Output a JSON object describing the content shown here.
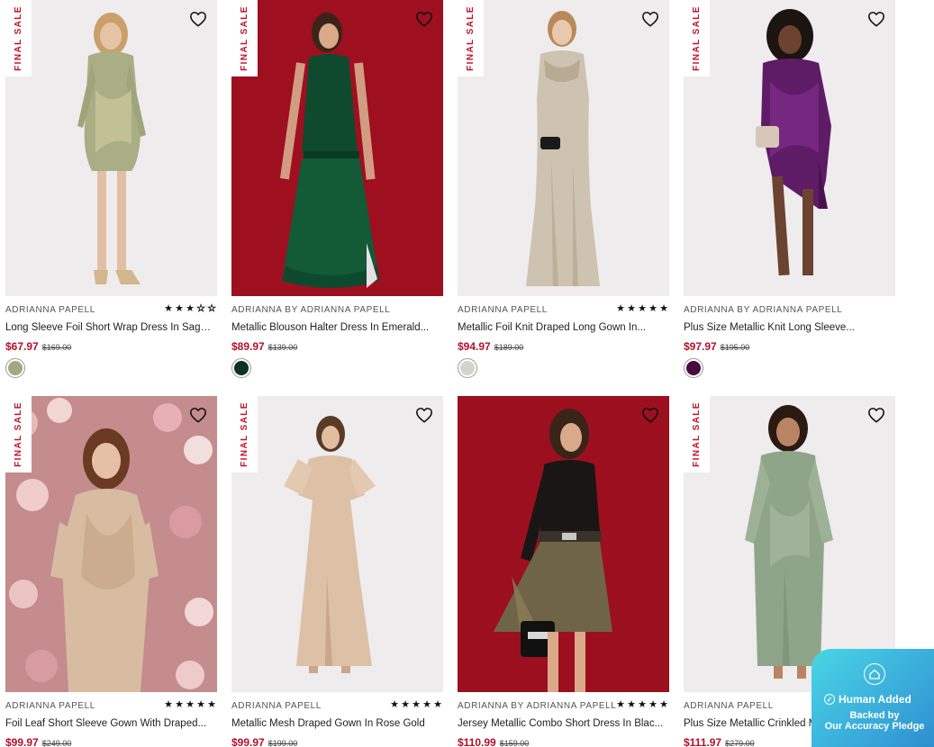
{
  "badge_text": "FINAL SALE",
  "colors": {
    "accent_red": "#b3112a",
    "badge_red": "#c3132a"
  },
  "products": [
    {
      "brand": "ADRIANNA PAPELL",
      "name": "Long Sleeve Foil Short Wrap Dress In Sage...",
      "price": "$67.97",
      "original_price": "$169.00",
      "rating": 2.5,
      "final_sale": true,
      "swatch": "#a8a585"
    },
    {
      "brand": "ADRIANNA BY ADRIANNA PAPELL",
      "name": "Metallic Blouson Halter Dress In Emerald...",
      "price": "$89.97",
      "original_price": "$139.00",
      "rating": null,
      "final_sale": true,
      "swatch": "#0c3322"
    },
    {
      "brand": "ADRIANNA PAPELL",
      "name": "Metallic Foil Knit Draped Long Gown In...",
      "price": "$94.97",
      "original_price": "$189.00",
      "rating": 4.5,
      "final_sale": true,
      "swatch": "#d7d3ca"
    },
    {
      "brand": "ADRIANNA BY ADRIANNA PAPELL",
      "name": "Plus Size Metallic Knit Long Sleeve...",
      "price": "$97.97",
      "original_price": "$195.00",
      "rating": null,
      "final_sale": true,
      "swatch": "#4a0a3e"
    },
    {
      "brand": "ADRIANNA PAPELL",
      "name": "Foil Leaf Short Sleeve Gown With Draped...",
      "price": "$99.97",
      "original_price": "$249.00",
      "rating": 5,
      "final_sale": true,
      "swatch": null
    },
    {
      "brand": "ADRIANNA PAPELL",
      "name": "Metallic Mesh Draped Gown In Rose Gold",
      "price": "$99.97",
      "original_price": "$199.00",
      "rating": 4.5,
      "final_sale": true,
      "swatch": null
    },
    {
      "brand": "ADRIANNA BY ADRIANNA PAPELL",
      "name": "Jersey Metallic Combo Short Dress In Blac...",
      "price": "$110.99",
      "original_price": "$159.00",
      "rating": 5,
      "final_sale": false,
      "swatch": null
    },
    {
      "brand": "ADRIANNA PAPELL",
      "name": "Plus Size Metallic Crinkled Mesh Draped...",
      "price": "$111.97",
      "original_price": "$279.00",
      "rating": null,
      "final_sale": true,
      "swatch": null
    }
  ],
  "pledge": {
    "title": "Human Added",
    "line1": "Backed by",
    "line2": "Our Accuracy Pledge"
  }
}
